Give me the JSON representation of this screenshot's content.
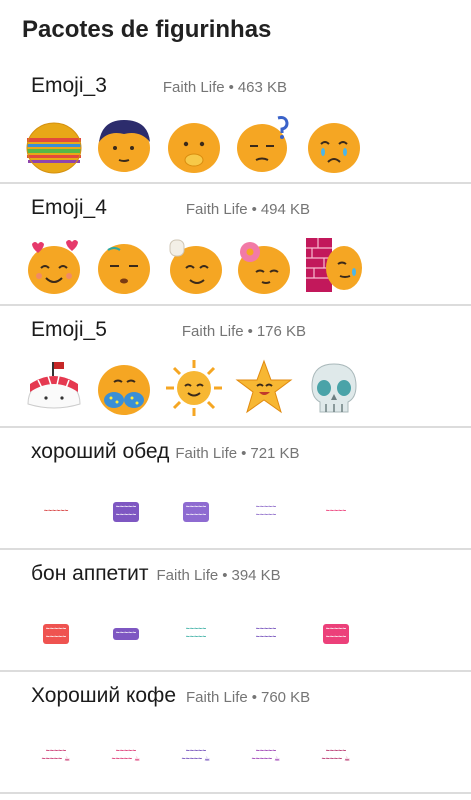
{
  "header": {
    "title": "Pacotes de figurinhas"
  },
  "packs": [
    {
      "name": "Emoji_3",
      "author": "Faith Life",
      "size": "463 KB",
      "stickers": [
        "striped-egg-sticker",
        "hair-blob-sticker",
        "duck-blob-sticker",
        "question-blob-sticker",
        "crying-blob-sticker"
      ]
    },
    {
      "name": "Emoji_4",
      "author": "Faith Life",
      "size": "494 KB",
      "stickers": [
        "love-blob-sticker",
        "sleepy-blob-sticker",
        "chef-blob-sticker",
        "donut-blob-sticker",
        "wall-blob-sticker"
      ]
    },
    {
      "name": "Emoji_5",
      "author": "Faith Life",
      "size": "176 KB",
      "stickers": [
        "sushi-sticker",
        "bikini-blob-sticker",
        "sun-sticker",
        "star-sticker",
        "skull-sticker"
      ]
    },
    {
      "name": "хороший обед",
      "author": "Faith Life",
      "size": "721 KB",
      "stickers": [
        "text-sticker-1",
        "text-sticker-2",
        "text-sticker-3",
        "text-sticker-4",
        "text-sticker-5"
      ]
    },
    {
      "name": "бон аппетит",
      "author": "Faith Life",
      "size": "394 KB",
      "stickers": [
        "text-sticker-1",
        "text-sticker-2",
        "text-sticker-3",
        "text-sticker-4",
        "text-sticker-5"
      ]
    },
    {
      "name": "Хороший кофе",
      "author": "Faith Life",
      "size": "760 KB",
      "stickers": [
        "text-sticker-1",
        "text-sticker-2",
        "text-sticker-3",
        "text-sticker-4",
        "text-sticker-5"
      ]
    }
  ],
  "separator": "•",
  "colors": {
    "blob": "#f5a623",
    "blob_shade": "#e08a10",
    "divider": "#dcdcdc",
    "meta": "#757575"
  }
}
